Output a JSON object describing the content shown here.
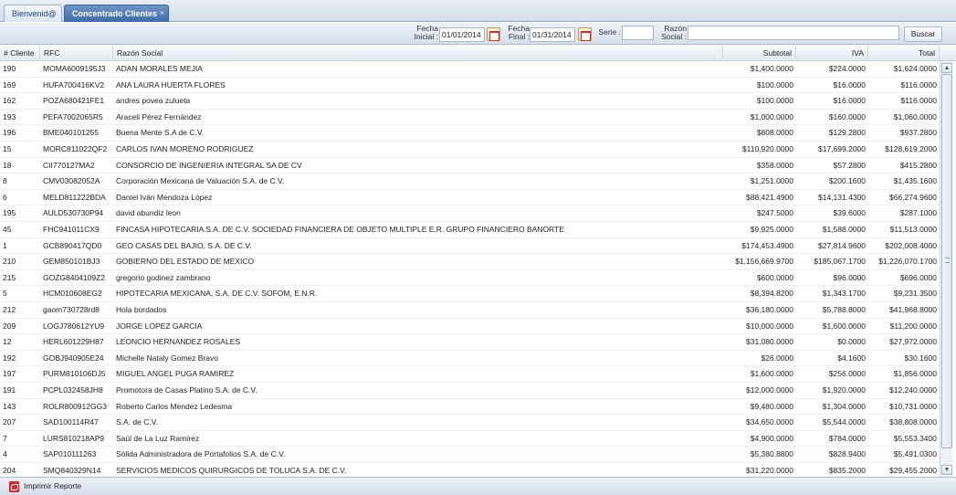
{
  "tabs": [
    {
      "label": "Bienvenid@",
      "active": false
    },
    {
      "label": "Concentrado Clientes",
      "active": true,
      "close": "×"
    }
  ],
  "toolbar": {
    "fecha_inicial_label": [
      "Fecha",
      "Inicial :"
    ],
    "fecha_inicial_value": "01/01/2014",
    "fecha_final_label": [
      "Fecha",
      "Final :"
    ],
    "fecha_final_value": "01/31/2014",
    "serie_label": "Serie :",
    "serie_value": "",
    "razon_label": [
      "Razón",
      "Social :"
    ],
    "razon_value": "",
    "buscar_label": "Buscar"
  },
  "grid": {
    "columns": [
      "# Cliente",
      "RFC",
      "Razón Social",
      "Subtotal",
      "IVA",
      "Total"
    ],
    "rows": [
      [
        "190",
        "MOMA6009195J3",
        "ADAN MORALES MEJIA",
        "$1,400.0000",
        "$224.0000",
        "$1,624.0000"
      ],
      [
        "169",
        "HUFA700416KV2",
        "ANA LAURA HUERTA FLORES",
        "$100.0000",
        "$16.0000",
        "$116.0000"
      ],
      [
        "162",
        "POZA680421FE1",
        "andres povea zulueta",
        "$100.0000",
        "$16.0000",
        "$116.0000"
      ],
      [
        "193",
        "PEFA7002065R5",
        "Araceli Pérez Fernández",
        "$1,000.0000",
        "$160.0000",
        "$1,060.0000"
      ],
      [
        "196",
        "BME040101255",
        "Buena Mente S.A de C.V.",
        "$808.0000",
        "$129.2800",
        "$937.2800"
      ],
      [
        "15",
        "MORC811022QF2",
        "CARLOS IVAN MORENO RODRIGUEZ",
        "$110,920.0000",
        "$17,699.2000",
        "$128,619.2000"
      ],
      [
        "18",
        "CII770127MA2",
        "CONSORCIO DE INGENIERIA INTEGRAL SA DE CV",
        "$358.0000",
        "$57.2800",
        "$415.2800"
      ],
      [
        "8",
        "CMV03082052A",
        "Corporación Mexicana de Valuación S.A. de C.V.",
        "$1,251.0000",
        "$200.1600",
        "$1,435.1600"
      ],
      [
        "6",
        "MELD811222BDA",
        "Daniel Iván Mendoza López",
        "$88,421.4900",
        "$14,131.4300",
        "$66,274.9600"
      ],
      [
        "195",
        "AULD530730P94",
        "david abundiz leon",
        "$247.5000",
        "$39.6000",
        "$287.1000"
      ],
      [
        "45",
        "FHC941011CX9",
        "FINCASA HIPOTECARIA S.A. DE C.V. SOCIEDAD FINANCIERA DE OBJETO MULTIPLE E.R. GRUPO FINANCIERO BANORTE",
        "$9,925.0000",
        "$1,588.0000",
        "$11,513.0000"
      ],
      [
        "1",
        "GCB890417QD0",
        "GEO CASAS DEL BAJIO, S.A. DE C.V.",
        "$174,453.4900",
        "$27,814.9600",
        "$202,008.4000"
      ],
      [
        "210",
        "GEM850101BJ3",
        "GOBIERNO DEL ESTADO DE MEXICO",
        "$1,156,669.9700",
        "$185,067.1700",
        "$1,226,070.1700"
      ],
      [
        "215",
        "GOZG8404109Z2",
        "gregorio godinez zambrano",
        "$600.0000",
        "$96.0000",
        "$696.0000"
      ],
      [
        "5",
        "HCM010608EG2",
        "HIPOTECARIA MEXICANA, S.A. DE C.V. SOFOM, E.N.R.",
        "$8,394.8200",
        "$1,343.1700",
        "$9,231.3500"
      ],
      [
        "212",
        "gaom730728rd8",
        "Hola bordados",
        "$36,180.0000",
        "$5,788.8000",
        "$41,968.8000"
      ],
      [
        "209",
        "LOGJ780612YU9",
        "JORGE LOPEZ GARCIA",
        "$10,000.0000",
        "$1,600.0000",
        "$11,200.0000"
      ],
      [
        "12",
        "HERL601229H87",
        "LEONCIO HERNANDEZ ROSALES",
        "$31,080.0000",
        "$0.0000",
        "$27,972.0000"
      ],
      [
        "192",
        "GOBJ940905E24",
        "Michelle Nataly Gomez Bravo",
        "$26.0000",
        "$4.1600",
        "$30.1600"
      ],
      [
        "197",
        "PURM810106DJ5",
        "MIGUEL ANGEL PUGA RAMIREZ",
        "$1,600.0000",
        "$256.0000",
        "$1,856.0000"
      ],
      [
        "191",
        "PCPL032458JH8",
        "Promotora de Casas Platino S.A. de C.V.",
        "$12,000.0000",
        "$1,920.0000",
        "$12,240.0000"
      ],
      [
        "143",
        "ROLR800912GG3",
        "Roberto Carlos Mendez Ledesma",
        "$9,480.0000",
        "$1,304.0000",
        "$10,731.0000"
      ],
      [
        "207",
        "SAD100114R47",
        "S.A. de C.V.",
        "$34,650.0000",
        "$5,544.0000",
        "$38,808.0000"
      ],
      [
        "7",
        "LURS810218AP9",
        "Saúl de La Luz Ramírez",
        "$4,900.0000",
        "$784.0000",
        "$5,553.3400"
      ],
      [
        "4",
        "SAP010111263",
        "Sólida Administradora de Portafolios S.A. de C.V.",
        "$5,380.8800",
        "$828.9400",
        "$5,491.0300"
      ],
      [
        "204",
        "SMQ840329N14",
        "SERVICIOS MEDICOS QUIRURGICOS DE TOLUCA S.A. DE C.V.",
        "$31,220.0000",
        "$835.2000",
        "$29,455.2000"
      ]
    ]
  },
  "footer": {
    "print_label": "Imprimir Reporte"
  },
  "icons": {
    "calendar": "calendar-icon",
    "pdf": "pdf-icon",
    "scroll_up": "▲",
    "scroll_down": "▼"
  },
  "colors": {
    "active_tab": "#4a76b0",
    "header_bg": "#e3e8ef",
    "toolbar_bg": "#dfe6f0"
  }
}
